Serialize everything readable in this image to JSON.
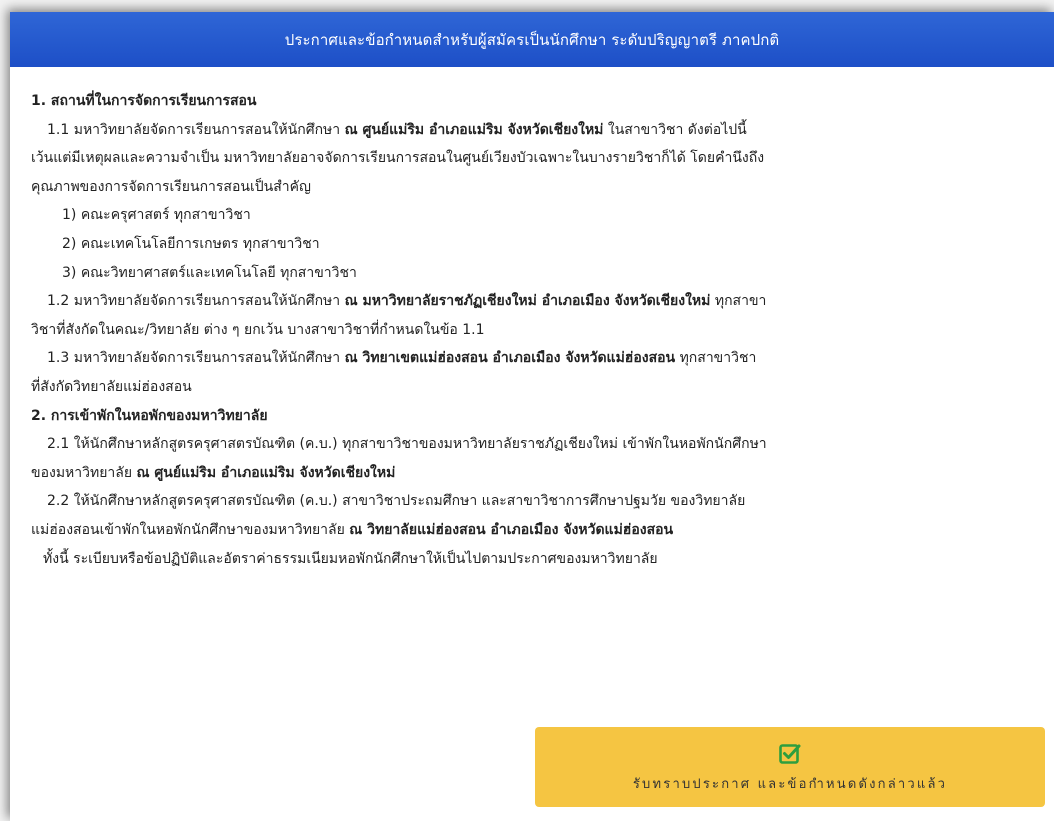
{
  "modal": {
    "title": "ประกาศและข้อกำหนดสำหรับผู้สมัครเป็นนักศึกษา ระดับปริญญาตรี ภาคปกติ"
  },
  "content": {
    "s1_heading": "1. สถานที่ในการจัดการเรียนการสอน",
    "s1_1_a": "1.1 มหาวิทยาลัยจัดการเรียนการสอนให้นักศึกษา ",
    "s1_1_b": "ณ ศูนย์แม่ริม อำเภอแม่ริม จังหวัดเชียงใหม่",
    "s1_1_c": " ในสาขาวิชา ดังต่อไปนี้",
    "s1_1_d": "เว้นแต่มีเหตุผลและความจำเป็น มหาวิทยาลัยอาจจัดการเรียนการสอนในศูนย์เวียงบัวเฉพาะในบางรายวิชาก็ได้ โดยคำนึงถึง",
    "s1_1_e": "คุณภาพของการจัดการเรียนการสอนเป็นสำคัญ",
    "items": [
      "1) คณะครุศาสตร์ ทุกสาขาวิชา",
      "2) คณะเทคโนโลยีการเกษตร ทุกสาขาวิชา",
      "3) คณะวิทยาศาสตร์และเทคโนโลยี ทุกสาขาวิชา"
    ],
    "s1_2_a": "1.2 มหาวิทยาลัยจัดการเรียนการสอนให้นักศึกษา ",
    "s1_2_b": "ณ มหาวิทยาลัยราชภัฏเชียงใหม่ อำเภอเมือง จังหวัดเชียงใหม่",
    "s1_2_c": " ทุกสาขา",
    "s1_2_d": "วิชาที่สังกัดในคณะ/วิทยาลัย ต่าง ๆ ยกเว้น บางสาขาวิชาที่กำหนดในข้อ 1.1",
    "s1_3_a": "1.3 มหาวิทยาลัยจัดการเรียนการสอนให้นักศึกษา ",
    "s1_3_b": "ณ วิทยาเขตแม่ฮ่องสอน อำเภอเมือง จังหวัดแม่ฮ่องสอน",
    "s1_3_c": " ทุกสาขาวิชา",
    "s1_3_d": "ที่สังกัดวิทยาลัยแม่ฮ่องสอน",
    "s2_heading": "2. การเข้าพักในหอพักของมหาวิทยาลัย",
    "s2_1_a": "2.1 ให้นักศึกษาหลักสูตรครุศาสตรบัณฑิต (ค.บ.) ทุกสาขาวิชาของมหาวิทยาลัยราชภัฏเชียงใหม่ เข้าพักในหอพักนักศึกษา",
    "s2_1_b": "ของมหาวิทยาลัย ",
    "s2_1_c": "ณ ศูนย์แม่ริม อำเภอแม่ริม จังหวัดเชียงใหม่",
    "s2_2_a": "2.2 ให้นักศึกษาหลักสูตรครุศาสตรบัณฑิต (ค.บ.) สาขาวิชาประถมศึกษา และสาขาวิชาการศึกษาปฐมวัย ของวิทยาลัย",
    "s2_2_b": "แม่ฮ่องสอนเข้าพักในหอพักนักศึกษาของมหาวิทยาลัย ",
    "s2_2_c": "ณ วิทยาลัยแม่ฮ่องสอน อำเภอเมือง จังหวัดแม่ฮ่องสอน",
    "closing": "ทั้งนี้ ระเบียบหรือข้อปฏิบัติและอัตราค่าธรรมเนียมหอพักนักศึกษาให้เป็นไปตามประกาศของมหาวิทยาลัย"
  },
  "accept_button": {
    "label": "รับทราบประกาศ และข้อกำหนดดังกล่าวแล้ว",
    "icon": "check-square-icon"
  },
  "colors": {
    "header_bg": "#1d4fc7",
    "button_bg": "#f5c542",
    "check_green": "#2e9e3e"
  }
}
